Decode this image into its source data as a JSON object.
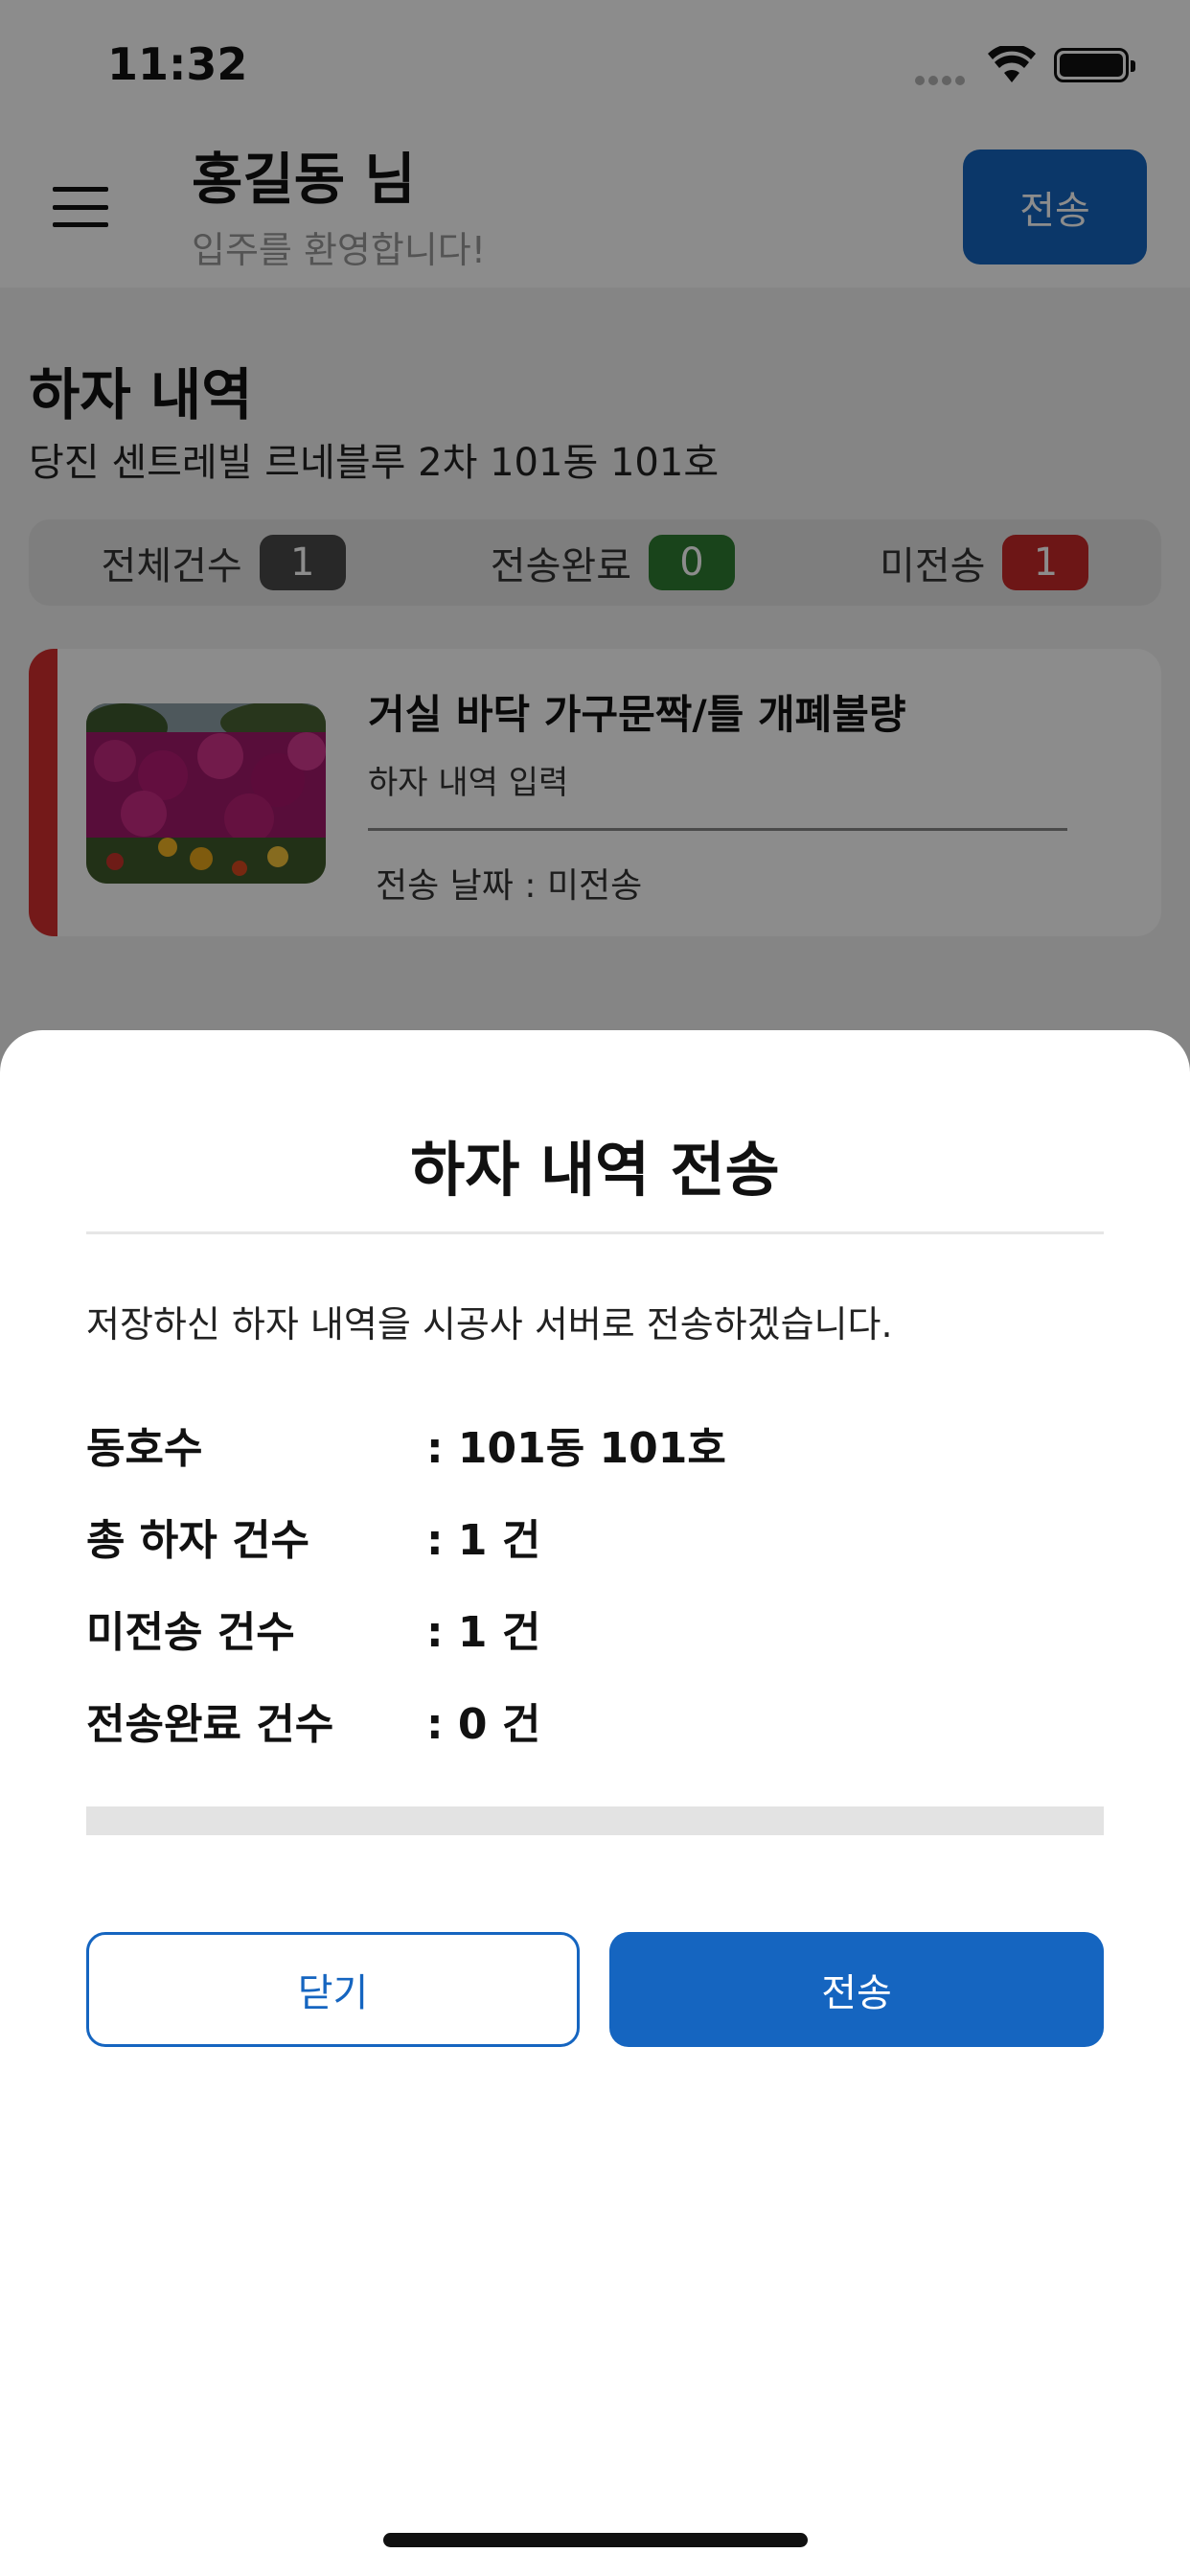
{
  "status_bar": {
    "time": "11:32"
  },
  "header": {
    "user_name": "홍길동 님",
    "welcome": "입주를 환영합니다!",
    "send_button": "전송"
  },
  "page": {
    "title": "하자 내역",
    "address": "당진 센트레빌 르네블루 2차 101동 101호"
  },
  "summary": {
    "items": [
      {
        "label": "전체건수",
        "count": "1",
        "color": "#4a4a4a"
      },
      {
        "label": "전송완료",
        "count": "0",
        "color": "#2e7d32"
      },
      {
        "label": "미전송",
        "count": "1",
        "color": "#c62828"
      }
    ]
  },
  "defect_card": {
    "title": "거실 바닥 가구문짝/틀 개폐불량",
    "subtitle": "하자 내역 입력",
    "date": "전송 날짜 : 미전송",
    "accent_color": "#d32f2f"
  },
  "dialog": {
    "title": "하자 내역 전송",
    "message": "저장하신 하자 내역을 시공사 서버로 전송하겠습니다.",
    "rows": [
      {
        "label": "동호수",
        "value": ": 101동 101호"
      },
      {
        "label": "총 하자 건수",
        "value": ": 1 건"
      },
      {
        "label": "미전송 건수",
        "value": ": 1 건"
      },
      {
        "label": "전송완료 건수",
        "value": ": 0 건"
      }
    ],
    "progress": 0,
    "close_button": "닫기",
    "send_button": "전송"
  },
  "colors": {
    "primary": "#1565c0",
    "overlay": "rgba(0,0,0,0.45)"
  }
}
